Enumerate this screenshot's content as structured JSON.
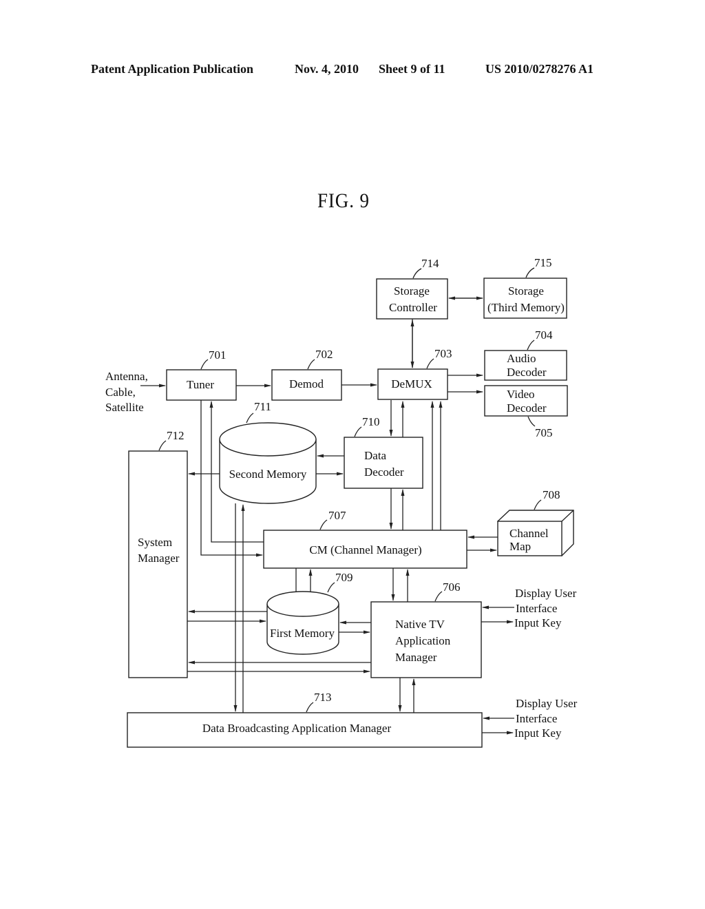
{
  "header": {
    "publication": "Patent Application Publication",
    "date": "Nov. 4, 2010",
    "sheet": "Sheet 9 of 11",
    "number": "US 2010/0278276 A1"
  },
  "figure": {
    "title": "FIG. 9"
  },
  "blocks": {
    "tuner": {
      "ref": "701",
      "label": "Tuner"
    },
    "demod": {
      "ref": "702",
      "label": "Demod"
    },
    "demux": {
      "ref": "703",
      "label": "DeMUX"
    },
    "audio_decoder": {
      "ref": "704",
      "label_1": "Audio",
      "label_2": "Decoder"
    },
    "video_decoder": {
      "ref": "705",
      "label_1": "Video",
      "label_2": "Decoder"
    },
    "native_tv_app_manager": {
      "ref": "706",
      "label_1": "Native TV",
      "label_2": "Application",
      "label_3": "Manager"
    },
    "channel_manager": {
      "ref": "707",
      "label": "CM (Channel Manager)"
    },
    "channel_map": {
      "ref": "708",
      "label_1": "Channel",
      "label_2": "Map"
    },
    "first_memory": {
      "ref": "709",
      "label": "First Memory"
    },
    "data_decoder": {
      "ref": "710",
      "label_1": "Data",
      "label_2": "Decoder"
    },
    "second_memory": {
      "ref": "711",
      "label": "Second Memory"
    },
    "system_manager": {
      "ref": "712",
      "label_1": "System",
      "label_2": "Manager"
    },
    "data_broadcasting_app_manager": {
      "ref": "713",
      "label": "Data Broadcasting Application Manager"
    },
    "storage_controller": {
      "ref": "714",
      "label_1": "Storage",
      "label_2": "Controller"
    },
    "storage": {
      "ref": "715",
      "label_1": "Storage",
      "label_2": "(Third Memory)"
    }
  },
  "inputs": {
    "source": {
      "line_1": "Antenna,",
      "line_2": "Cable,",
      "line_3": "Satellite"
    },
    "ui_native": {
      "line_1": "Display User",
      "line_2": "Interface",
      "line_3": "Input Key"
    },
    "ui_data": {
      "line_1": "Display User",
      "line_2": "Interface",
      "line_3": "Input Key"
    }
  }
}
